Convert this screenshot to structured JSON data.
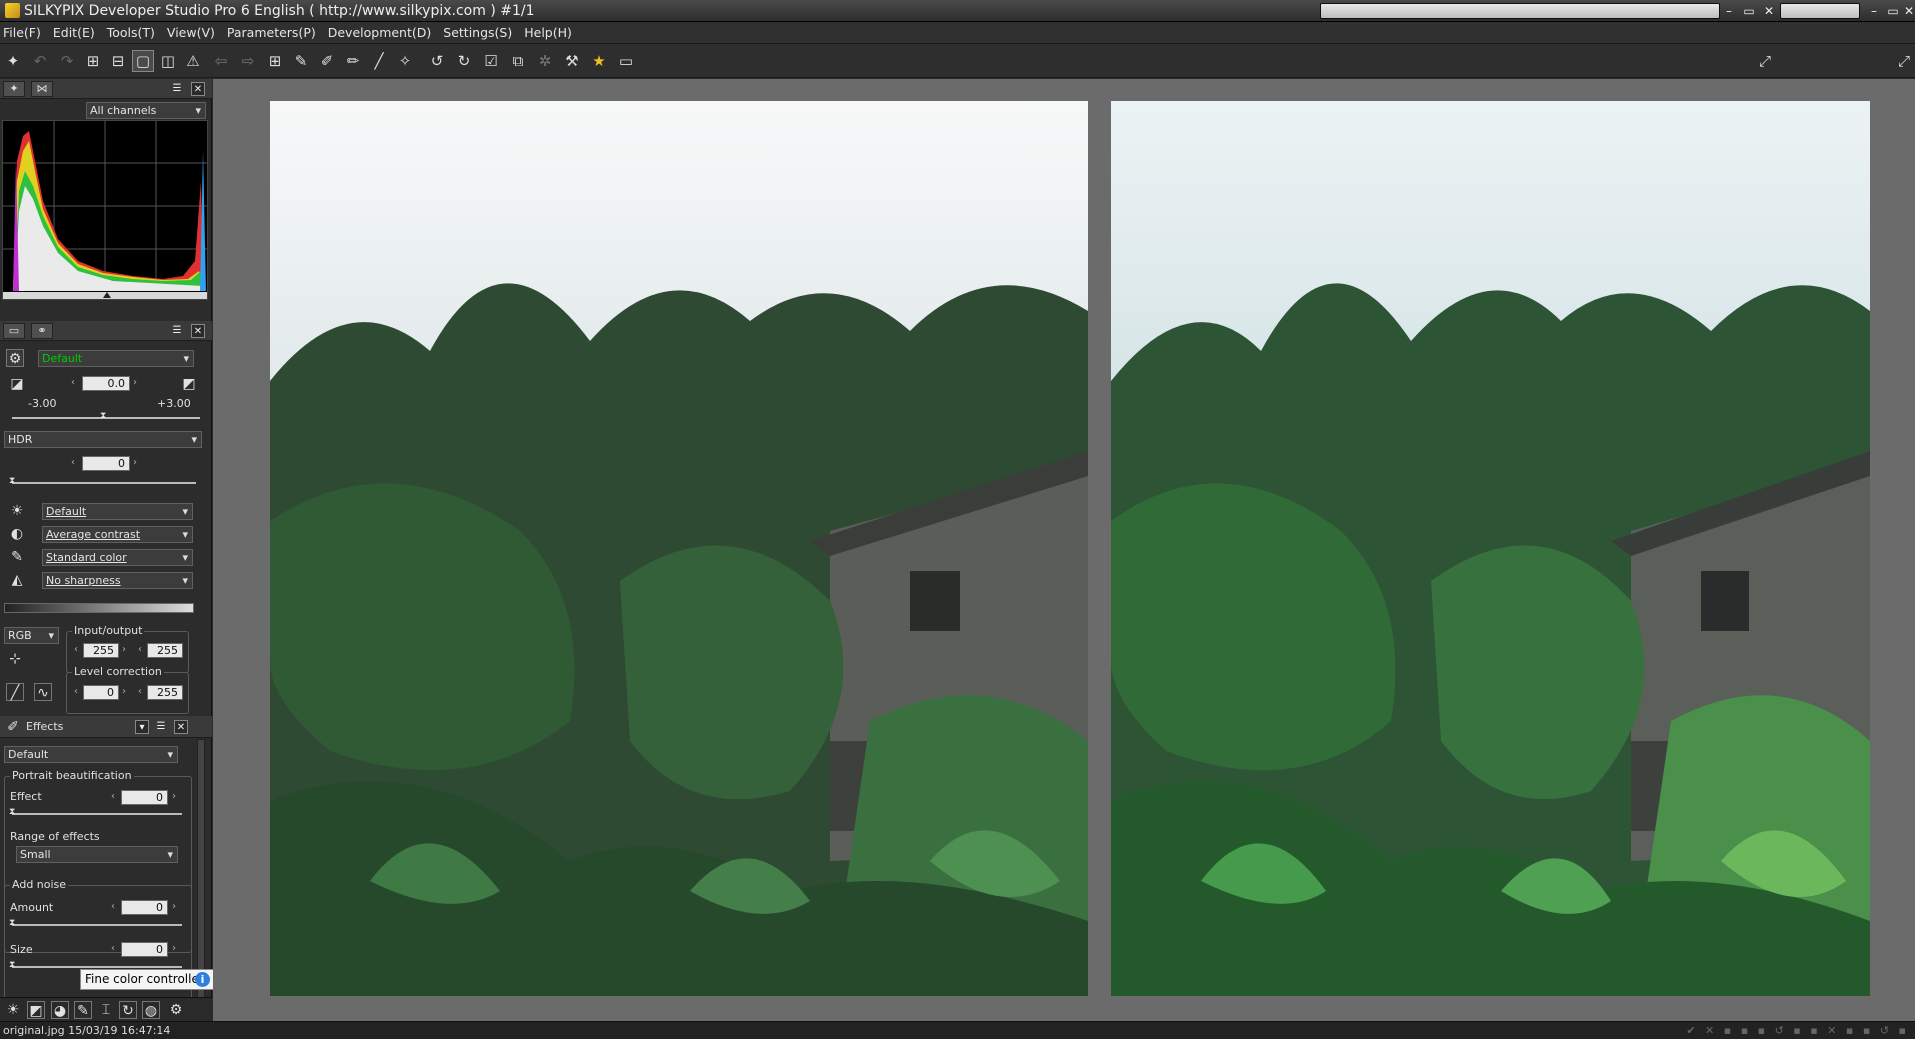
{
  "window": {
    "title": "SILKYPIX Developer Studio Pro 6 English ( http://www.silkypix.com )  #1/1",
    "minimize": "–",
    "restore": "▭",
    "close": "✕"
  },
  "menu": [
    "File(F)",
    "Edit(E)",
    "Tools(T)",
    "View(V)",
    "Parameters(P)",
    "Development(D)",
    "Settings(S)",
    "Help(H)"
  ],
  "histogram": {
    "channel": "All channels"
  },
  "taste": {
    "preset": "Default"
  },
  "exposure": {
    "value": "0.0",
    "min": "-3.00",
    "max": "+3.00"
  },
  "hdr": {
    "label": "HDR",
    "value": "0"
  },
  "dropdowns": {
    "white_balance": "Default",
    "contrast": "Average contrast",
    "color": "Standard color",
    "sharpness": "No sharpness"
  },
  "tone_curve": {
    "channel": "RGB",
    "input_output_label": "Input/output",
    "input": "255",
    "output": "255",
    "level_label": "Level correction",
    "level_low": "0",
    "level_high": "255"
  },
  "effects": {
    "title": "Effects",
    "preset": "Default",
    "portrait_group": "Portrait beautification",
    "effect_label": "Effect",
    "effect_value": "0",
    "range_label": "Range of effects",
    "range_value": "Small",
    "noise_group": "Add noise",
    "amount_label": "Amount",
    "amount_value": "0",
    "size_label": "Size",
    "size_value": "0"
  },
  "tooltip": "Fine color controller",
  "status": {
    "file": "original.jpg  15/03/19 16:47:14"
  },
  "colors": {
    "accent_info": "#2f7fe0",
    "viewer_bg": "#6b6b6b"
  }
}
